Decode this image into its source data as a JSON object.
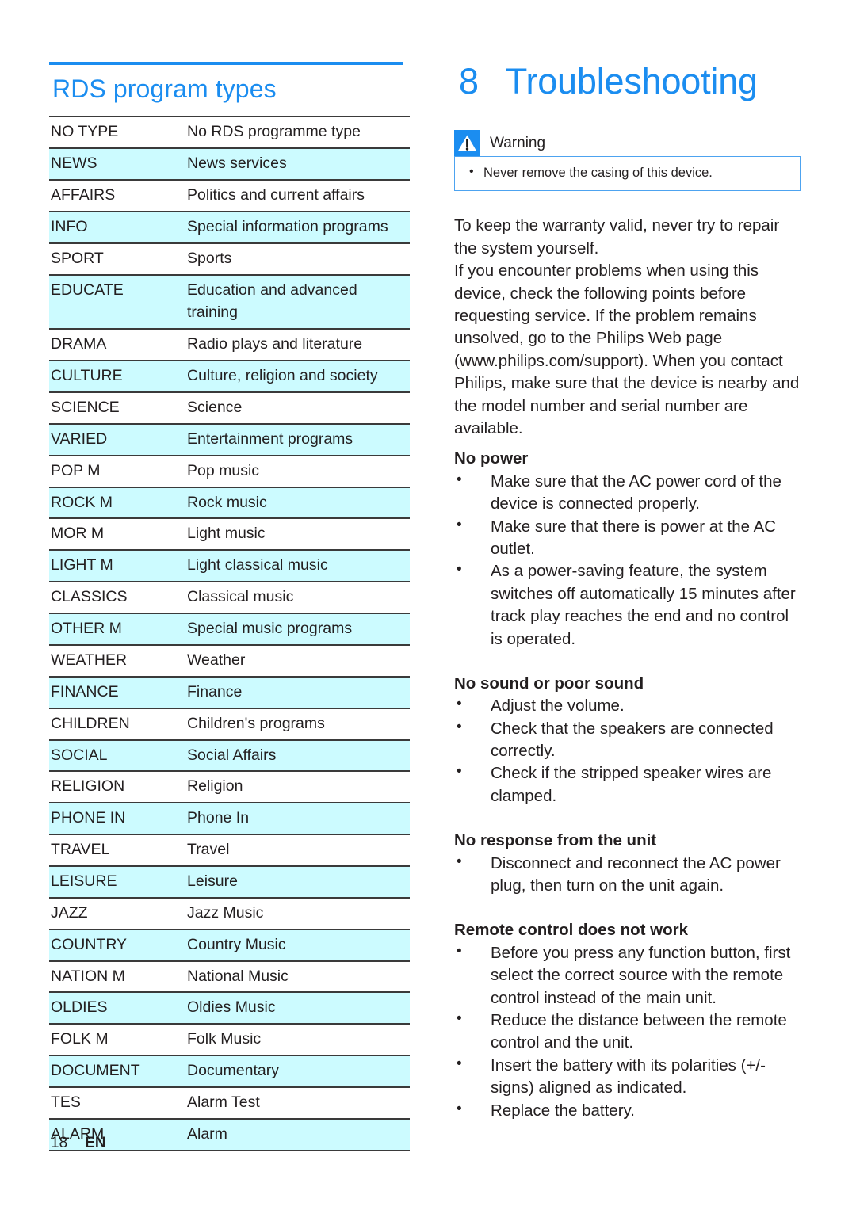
{
  "page": {
    "footer_page_number": "18",
    "footer_language": "EN",
    "accent_color": "#1b8df0",
    "row_highlight_color": "#ccfbff",
    "text_color": "#231f20"
  },
  "left_column": {
    "title_lead": "RDS",
    "title_rest": " program types",
    "table": {
      "rows": [
        {
          "code": "NO TYPE",
          "description": "No RDS programme type"
        },
        {
          "code": "NEWS",
          "description": "News services"
        },
        {
          "code": "AFFAIRS",
          "description": "Politics and current affairs"
        },
        {
          "code": "INFO",
          "description": "Special information programs"
        },
        {
          "code": "SPORT",
          "description": "Sports"
        },
        {
          "code": "EDUCATE",
          "description": "Education and advanced training"
        },
        {
          "code": "DRAMA",
          "description": "Radio plays and literature"
        },
        {
          "code": "CULTURE",
          "description": "Culture, religion and society"
        },
        {
          "code": "SCIENCE",
          "description": "Science"
        },
        {
          "code": "VARIED",
          "description": "Entertainment programs"
        },
        {
          "code": "POP M",
          "description": "Pop music"
        },
        {
          "code": "ROCK M",
          "description": "Rock music"
        },
        {
          "code": "MOR M",
          "description": "Light music"
        },
        {
          "code": "LIGHT M",
          "description": "Light classical music"
        },
        {
          "code": "CLASSICS",
          "description": "Classical music"
        },
        {
          "code": "OTHER M",
          "description": "Special music programs"
        },
        {
          "code": "WEATHER",
          "description": "Weather"
        },
        {
          "code": "FINANCE",
          "description": "Finance"
        },
        {
          "code": "CHILDREN",
          "description": "Children's programs"
        },
        {
          "code": "SOCIAL",
          "description": "Social Affairs"
        },
        {
          "code": "RELIGION",
          "description": "Religion"
        },
        {
          "code": "PHONE IN",
          "description": "Phone In"
        },
        {
          "code": "TRAVEL",
          "description": "Travel"
        },
        {
          "code": "LEISURE",
          "description": "Leisure"
        },
        {
          "code": "JAZZ",
          "description": "Jazz Music"
        },
        {
          "code": "COUNTRY",
          "description": "Country Music"
        },
        {
          "code": "NATION M",
          "description": "National Music"
        },
        {
          "code": "OLDIES",
          "description": "Oldies Music"
        },
        {
          "code": "FOLK M",
          "description": "Folk Music"
        },
        {
          "code": "DOCUMENT",
          "description": "Documentary"
        },
        {
          "code": "TES",
          "description": "Alarm Test"
        },
        {
          "code": "ALARM",
          "description": "Alarm"
        }
      ]
    }
  },
  "right_column": {
    "chapter_number": "8",
    "chapter_title": "Troubleshooting",
    "warning": {
      "label": "Warning",
      "items": [
        "Never remove the casing of this device."
      ]
    },
    "intro_paragraph_1": "To keep the warranty valid, never try to repair the system yourself.",
    "intro_paragraph_2": "If you encounter problems when using this device, check the following points before requesting service. If the problem remains unsolved, go to the Philips Web page (www.philips.com/support). When you contact Philips, make sure that the device is nearby and the model number and serial number are available.",
    "sections": [
      {
        "heading": "No power",
        "items": [
          "Make sure that the AC power cord of the device is connected properly.",
          "Make sure that there is power at the AC outlet.",
          "As a power-saving feature, the system switches off automatically 15 minutes after track play reaches the end and no control is operated."
        ]
      },
      {
        "heading": "No sound or poor sound",
        "items": [
          "Adjust the volume.",
          "Check that the speakers are connected correctly.",
          "Check if the stripped speaker wires are clamped."
        ]
      },
      {
        "heading": "No response from the unit",
        "items": [
          "Disconnect and reconnect the AC power plug, then turn on the unit again."
        ]
      },
      {
        "heading": "Remote control does not work",
        "items": [
          "Before you press any function button, first select the correct source with the remote control instead of the main unit.",
          "Reduce the distance between the remote control and the unit.",
          "Insert the battery with its polarities (+/- signs) aligned as indicated.",
          "Replace the battery."
        ]
      }
    ]
  }
}
